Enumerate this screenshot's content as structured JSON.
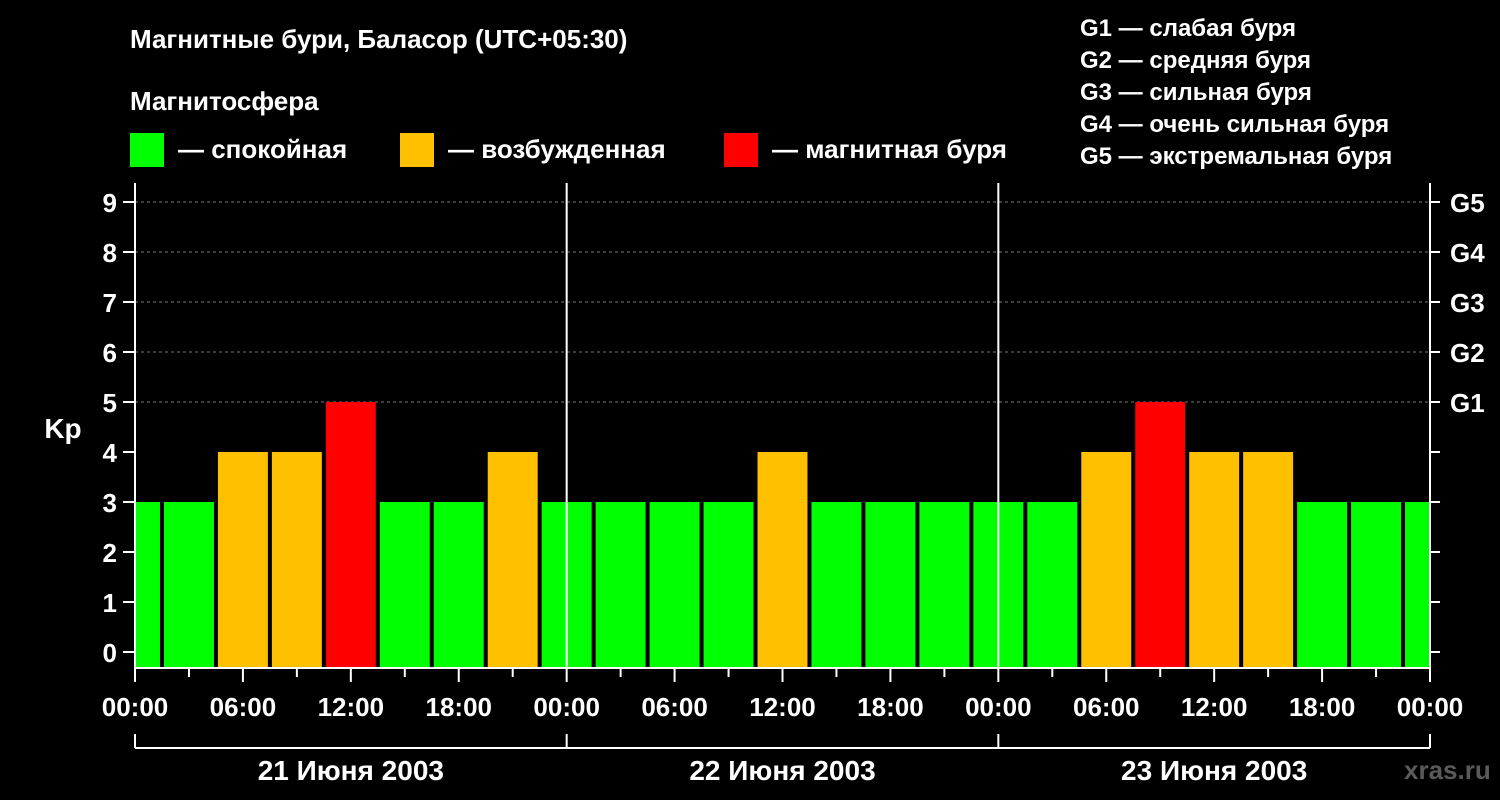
{
  "title": "Магнитные бури, Баласор (UTC+05:30)",
  "magnetosphere_label": "Магнитосфера",
  "legend": [
    {
      "label": "— спокойная",
      "color": "#00ff00"
    },
    {
      "label": "— возбужденная",
      "color": "#ffc000"
    },
    {
      "label": "— магнитная буря",
      "color": "#ff0000"
    }
  ],
  "g_scale": [
    "G1 — слабая буря",
    "G2 — средняя буря",
    "G3 — сильная буря",
    "G4 — очень сильная буря",
    "G5 — экстремальная буря"
  ],
  "watermark": "xras.ru",
  "colors": {
    "quiet": "#00ff00",
    "unsettled": "#ffc000",
    "storm": "#ff0000",
    "background": "#000000",
    "axis": "#ffffff"
  },
  "chart_data": {
    "type": "bar",
    "ylabel": "Kp",
    "ylim": [
      0,
      9
    ],
    "y_ticks": [
      "0",
      "1",
      "2",
      "3",
      "4",
      "5",
      "6",
      "7",
      "8",
      "9"
    ],
    "right_ticks": [
      {
        "y": 5,
        "label": "G1"
      },
      {
        "y": 6,
        "label": "G2"
      },
      {
        "y": 7,
        "label": "G3"
      },
      {
        "y": 8,
        "label": "G4"
      },
      {
        "y": 9,
        "label": "G5"
      }
    ],
    "x_tick_labels": [
      "00:00",
      "06:00",
      "12:00",
      "18:00",
      "00:00",
      "06:00",
      "12:00",
      "18:00",
      "00:00",
      "06:00",
      "12:00",
      "18:00",
      "00:00"
    ],
    "x_range_hours": [
      0,
      72
    ],
    "day_labels": [
      "21 Июня 2003",
      "22 Июня 2003",
      "23 Июня 2003"
    ],
    "grid": "dashed horizontal",
    "bars": [
      {
        "start": 0,
        "end": 1.5,
        "kp": 3,
        "level": "quiet"
      },
      {
        "start": 1.5,
        "end": 4.5,
        "kp": 3,
        "level": "quiet"
      },
      {
        "start": 4.5,
        "end": 7.5,
        "kp": 4,
        "level": "unsettled"
      },
      {
        "start": 7.5,
        "end": 10.5,
        "kp": 4,
        "level": "unsettled"
      },
      {
        "start": 10.5,
        "end": 13.5,
        "kp": 5,
        "level": "storm"
      },
      {
        "start": 13.5,
        "end": 16.5,
        "kp": 3,
        "level": "quiet"
      },
      {
        "start": 16.5,
        "end": 19.5,
        "kp": 3,
        "level": "quiet"
      },
      {
        "start": 19.5,
        "end": 22.5,
        "kp": 4,
        "level": "unsettled"
      },
      {
        "start": 22.5,
        "end": 25.5,
        "kp": 3,
        "level": "quiet"
      },
      {
        "start": 25.5,
        "end": 28.5,
        "kp": 3,
        "level": "quiet"
      },
      {
        "start": 28.5,
        "end": 31.5,
        "kp": 3,
        "level": "quiet"
      },
      {
        "start": 31.5,
        "end": 34.5,
        "kp": 3,
        "level": "quiet"
      },
      {
        "start": 34.5,
        "end": 37.5,
        "kp": 4,
        "level": "unsettled"
      },
      {
        "start": 37.5,
        "end": 40.5,
        "kp": 3,
        "level": "quiet"
      },
      {
        "start": 40.5,
        "end": 43.5,
        "kp": 3,
        "level": "quiet"
      },
      {
        "start": 43.5,
        "end": 46.5,
        "kp": 3,
        "level": "quiet"
      },
      {
        "start": 46.5,
        "end": 49.5,
        "kp": 3,
        "level": "quiet"
      },
      {
        "start": 49.5,
        "end": 52.5,
        "kp": 3,
        "level": "quiet"
      },
      {
        "start": 52.5,
        "end": 55.5,
        "kp": 4,
        "level": "unsettled"
      },
      {
        "start": 55.5,
        "end": 58.5,
        "kp": 5,
        "level": "storm"
      },
      {
        "start": 58.5,
        "end": 61.5,
        "kp": 4,
        "level": "unsettled"
      },
      {
        "start": 61.5,
        "end": 64.5,
        "kp": 4,
        "level": "unsettled"
      },
      {
        "start": 64.5,
        "end": 67.5,
        "kp": 3,
        "level": "quiet"
      },
      {
        "start": 67.5,
        "end": 70.5,
        "kp": 3,
        "level": "quiet"
      },
      {
        "start": 70.5,
        "end": 72,
        "kp": 3,
        "level": "quiet"
      }
    ]
  }
}
